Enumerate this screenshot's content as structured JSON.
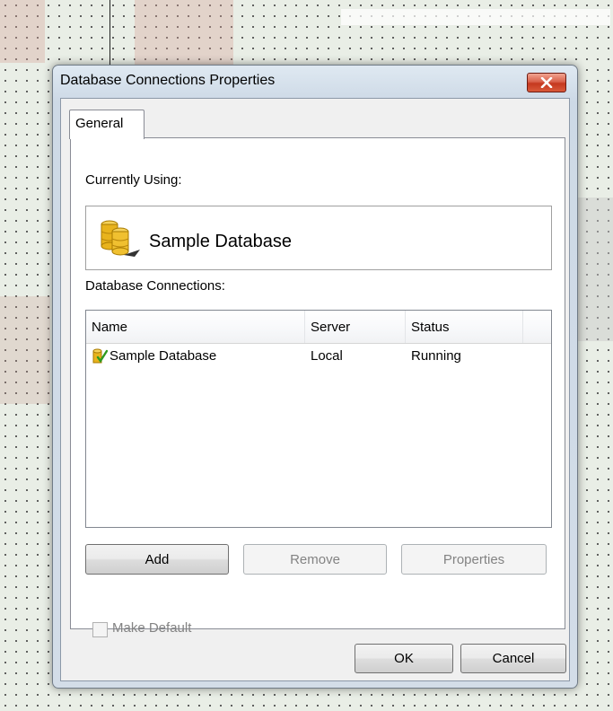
{
  "dialog": {
    "title": "Database Connections Properties"
  },
  "tabs": [
    {
      "label": "General",
      "active": true
    }
  ],
  "general": {
    "currently_using_label": "Currently Using:",
    "current_database": "Sample Database",
    "connections_label": "Database Connections:",
    "columns": [
      "Name",
      "Server",
      "Status"
    ],
    "rows": [
      {
        "name": "Sample Database",
        "server": "Local",
        "status": "Running",
        "icon": "database-check-icon"
      }
    ],
    "buttons": {
      "add": "Add",
      "remove": "Remove",
      "properties": "Properties"
    },
    "make_default_label": "Make Default",
    "make_default_checked": false
  },
  "footer": {
    "ok": "OK",
    "cancel": "Cancel"
  },
  "colors": {
    "close_button": "#c5381f",
    "database_icon": "#e8b31c"
  }
}
